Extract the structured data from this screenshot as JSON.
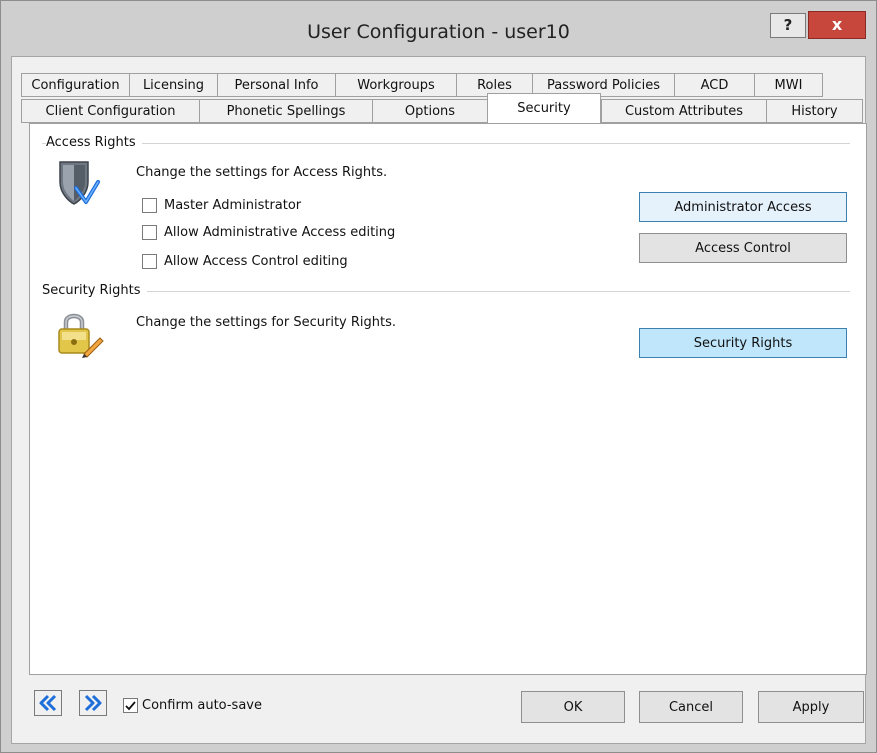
{
  "window": {
    "title": "User Configuration - user10",
    "help_label": "?",
    "close_label": "x"
  },
  "tabs": {
    "row1": [
      {
        "label": "Configuration",
        "width": 108
      },
      {
        "label": "Licensing",
        "width": 88
      },
      {
        "label": "Personal Info",
        "width": 118
      },
      {
        "label": "Workgroups",
        "width": 121
      },
      {
        "label": "Roles",
        "width": 76
      },
      {
        "label": "Password Policies",
        "width": 142
      },
      {
        "label": "ACD",
        "width": 80
      },
      {
        "label": "MWI",
        "width": 69
      }
    ],
    "row2": [
      {
        "label": "Client Configuration",
        "width": 178,
        "active": false
      },
      {
        "label": "Phonetic Spellings",
        "width": 173,
        "active": false
      },
      {
        "label": "Options",
        "width": 115,
        "active": false
      },
      {
        "label": "Security",
        "width": 114,
        "active": true
      },
      {
        "label": "Custom Attributes",
        "width": 165,
        "active": false
      },
      {
        "label": "History",
        "width": 97,
        "active": false
      }
    ]
  },
  "access_rights": {
    "group_label": "Access Rights",
    "description": "Change the settings for Access Rights.",
    "icon": "shield-icon",
    "checkboxes": [
      {
        "label": "Master Administrator",
        "checked": false
      },
      {
        "label": "Allow Administrative Access editing",
        "checked": false
      },
      {
        "label": "Allow Access Control editing",
        "checked": false
      }
    ],
    "admin_access_label": "Administrator Access",
    "access_control_label": "Access Control"
  },
  "security_rights": {
    "group_label": "Security Rights",
    "description": "Change the settings for Security Rights.",
    "icon": "lock-icon",
    "button_label": "Security Rights"
  },
  "footer": {
    "prev_icon": "double-chevron-left-icon",
    "next_icon": "double-chevron-right-icon",
    "confirm_auto_save_label": "Confirm auto-save",
    "confirm_auto_save_checked": true,
    "ok_label": "OK",
    "cancel_label": "Cancel",
    "apply_label": "Apply"
  },
  "colors": {
    "accent_blue": "#1e6fd9",
    "close_red": "#c7473d",
    "hot_button": "#bfe6fb"
  }
}
